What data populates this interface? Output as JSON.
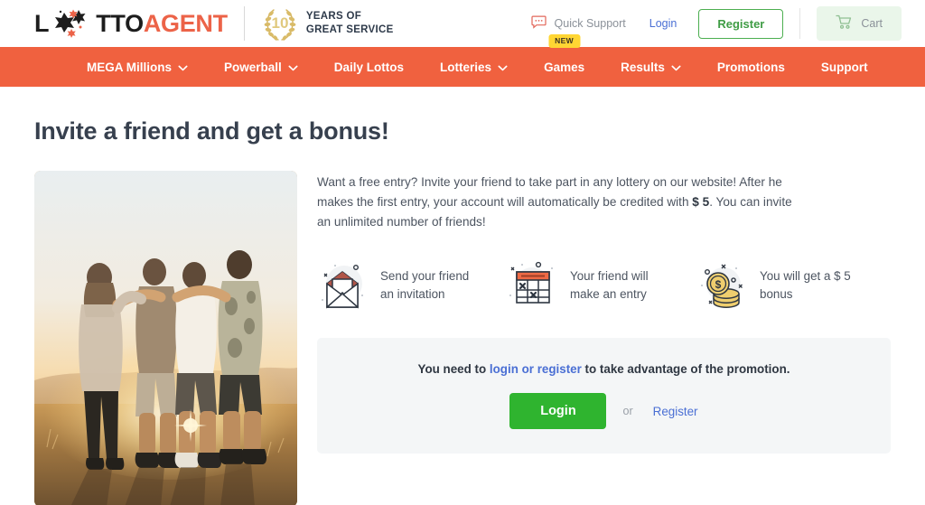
{
  "header": {
    "logo": {
      "part1": "L",
      "part2": "TTO",
      "part3": "AGENT",
      "stars_icon": "stars-icon"
    },
    "anniversary": {
      "number": "10",
      "line1": "YEARS OF",
      "line2": "GREAT SERVICE",
      "icon": "laurel-wreath-icon"
    },
    "quick_support": {
      "label": "Quick Support",
      "icon": "chat-bubble-icon"
    },
    "login_label": "Login",
    "register_label": "Register",
    "cart": {
      "label": "Cart",
      "icon": "shopping-cart-icon"
    }
  },
  "nav": {
    "items": [
      {
        "label": "MEGA Millions",
        "has_caret": true,
        "badge": ""
      },
      {
        "label": "Powerball",
        "has_caret": true,
        "badge": ""
      },
      {
        "label": "Daily Lottos",
        "has_caret": false,
        "badge": ""
      },
      {
        "label": "Lotteries",
        "has_caret": true,
        "badge": ""
      },
      {
        "label": "Games",
        "has_caret": false,
        "badge": "NEW"
      },
      {
        "label": "Results",
        "has_caret": true,
        "badge": ""
      },
      {
        "label": "Promotions",
        "has_caret": false,
        "badge": ""
      },
      {
        "label": "Support",
        "has_caret": false,
        "badge": ""
      }
    ]
  },
  "page": {
    "title": "Invite a friend and get a bonus!",
    "photo_alt": "four-friends-sunset-photo",
    "intro": {
      "part1": "Want a free entry? Invite your friend to take part in any lottery on our website! After he makes the first entry, your account will automatically be credited with ",
      "amount": "$ 5",
      "part2": ". You can invite an unlimited number of friends!"
    },
    "steps": [
      {
        "icon": "open-envelope-icon",
        "text": "Send your friend an invitation"
      },
      {
        "icon": "lottery-ticket-icon",
        "text": "Your friend will make an entry"
      },
      {
        "icon": "gold-coins-icon",
        "text": "You will get a $ 5 bonus"
      }
    ],
    "promo": {
      "text_before": "You need to ",
      "link_text": "login or register",
      "text_after": " to take advantage of the promotion.",
      "login_button": "Login",
      "or": "or",
      "register_link": "Register"
    }
  },
  "colors": {
    "nav_orange": "#f0613f",
    "accent_orange": "#ec6348",
    "link_blue": "#4a6fd4",
    "button_green": "#2fb42f",
    "register_green": "#3f9c44",
    "badge_yellow": "#ffd633",
    "promo_bg": "#f4f6f7",
    "title_dark": "#37404e"
  }
}
